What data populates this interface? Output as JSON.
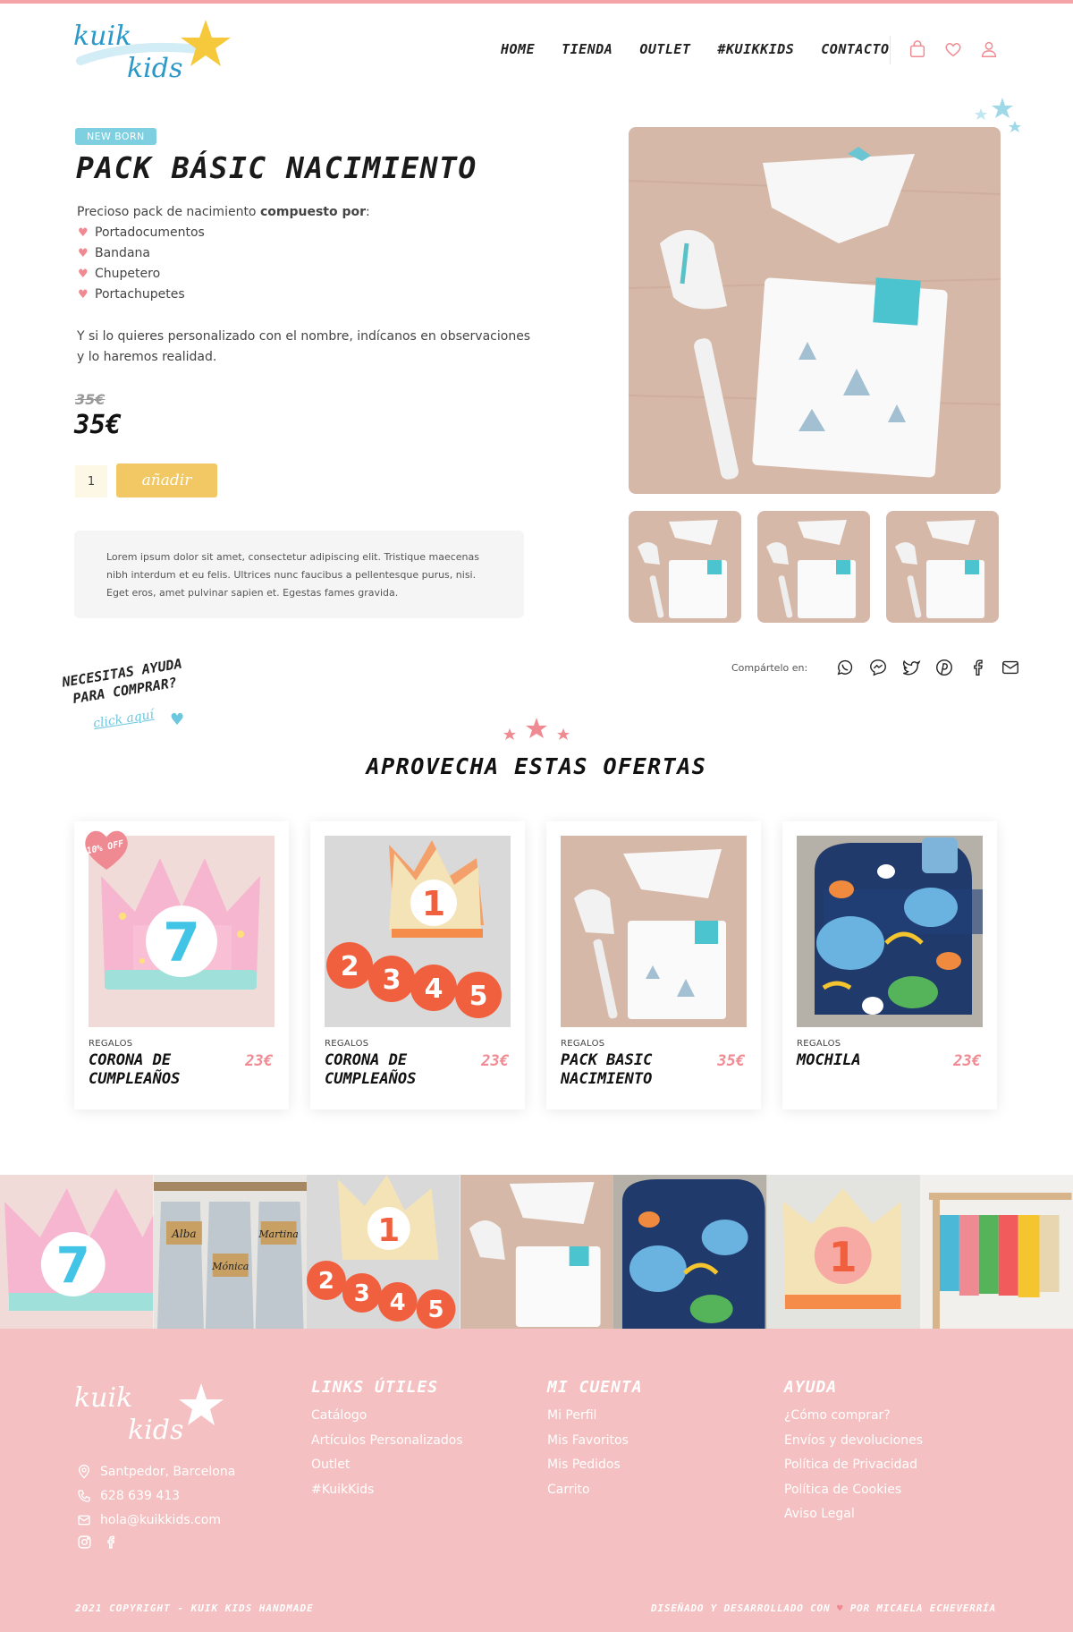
{
  "brand": {
    "name": "kuik kids",
    "accent": "#f4a3a6",
    "blue": "#4bb8d8",
    "yellow": "#f1c863",
    "pink": "#f08a92"
  },
  "nav": [
    "HOME",
    "TIENDA",
    "OUTLET",
    "#KUIKKIDS",
    "CONTACTO"
  ],
  "nav_active": "TIENDA",
  "header_icons": [
    "bag-icon",
    "heart-icon",
    "user-icon"
  ],
  "product": {
    "badge": "NEW BORN",
    "title": "PACK BÁSIC NACIMIENTO",
    "intro_plain": "Precioso pack de nacimiento ",
    "intro_bold": "compuesto por",
    "intro_colon": ":",
    "items": [
      "Portadocumentos",
      "Bandana",
      "Chupetero",
      "Portachupetes"
    ],
    "personalize": "Y si lo quieres personalizado con el nombre, indícanos en observaciones y lo haremos realidad.",
    "price_old": "35€",
    "price_new": "35€",
    "quantity": "1",
    "add_button": "añadir",
    "info_text": "Lorem ipsum dolor sit amet, consectetur adipiscing elit. Tristique maecenas nibh interdum et eu felis. Ultrices nunc faucibus a pellentesque purus, nisi. Eget eros, amet pulvinar sapien et. Egestas fames gravida."
  },
  "share": {
    "label": "Compártelo en:",
    "icons": [
      "whatsapp-icon",
      "messenger-icon",
      "twitter-icon",
      "pinterest-icon",
      "facebook-icon",
      "email-icon"
    ]
  },
  "help": {
    "line1": "NECESITAS AYUDA",
    "line2": "PARA COMPRAR?",
    "link": "click aquí"
  },
  "offers": {
    "title": "APROVECHA ESTAS OFERTAS",
    "sale_tag": "10% OFF",
    "cards": [
      {
        "category": "REGALOS",
        "name": "CORONA DE CUMPLEAÑOS",
        "price": "23€"
      },
      {
        "category": "REGALOS",
        "name": "CORONA DE CUMPLEAÑOS",
        "price": "23€"
      },
      {
        "category": "REGALOS",
        "name": "PACK BASIC NACIMIENTO",
        "price": "35€"
      },
      {
        "category": "REGALOS",
        "name": "MOCHILA",
        "price": "23€"
      }
    ]
  },
  "instagram_names": [
    "Alba",
    "Mónica",
    "Martina"
  ],
  "footer": {
    "address": "Santpedor, Barcelona",
    "phone": "628 639 413",
    "email": "hola@kuikkids.com",
    "col1_title": "LINKS ÚTILES",
    "col1_links": [
      "Catálogo",
      "Artículos Personalizados",
      "Outlet",
      "#KuikKids"
    ],
    "col2_title": "MI CUENTA",
    "col2_links": [
      "Mi Perfil",
      "Mis Favoritos",
      "Mis Pedidos",
      "Carrito"
    ],
    "col3_title": "AYUDA",
    "col3_links": [
      "¿Cómo comprar?",
      "Envíos y devoluciones",
      "Política de Privacidad",
      "Política de Cookies",
      "Aviso Legal"
    ],
    "copyright": "2021 COPYRIGHT - KUIK KIDS HANDMADE",
    "credit_before": "DISEÑADO Y DESARROLLADO CON",
    "credit_after": "POR MICAELA ECHEVERRÍA"
  }
}
